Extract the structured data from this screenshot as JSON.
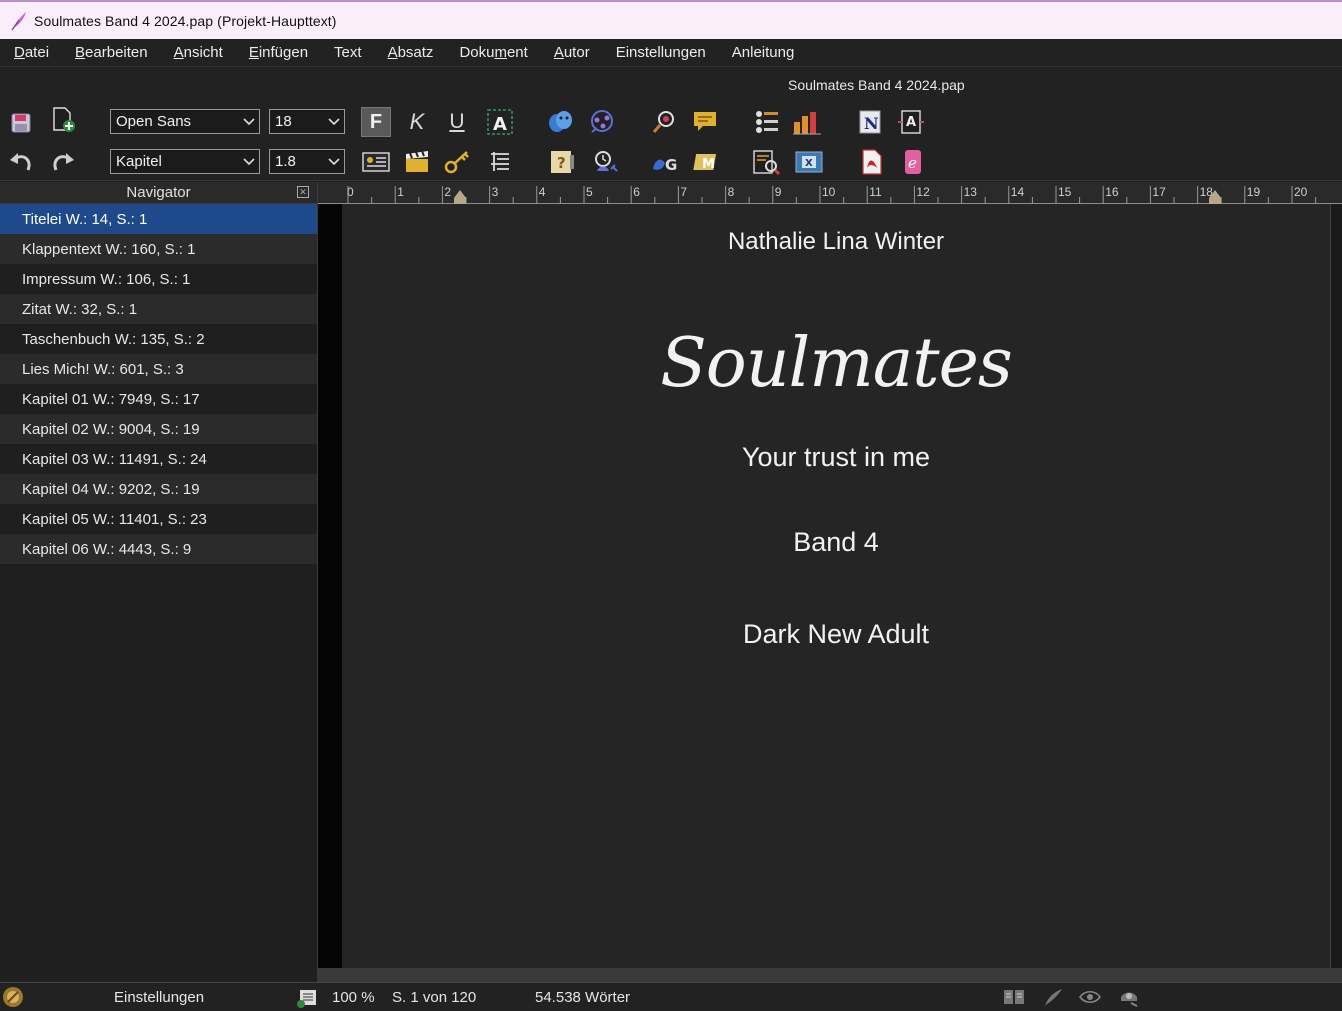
{
  "window": {
    "title": "Soulmates Band 4 2024.pap  (Projekt-Haupttext)"
  },
  "menu": [
    {
      "pre": "",
      "key": "D",
      "post": "atei"
    },
    {
      "pre": "",
      "key": "B",
      "post": "earbeiten"
    },
    {
      "pre": "",
      "key": "A",
      "post": "nsicht"
    },
    {
      "pre": "",
      "key": "E",
      "post": "infügen"
    },
    {
      "pre": "Text",
      "key": "",
      "post": ""
    },
    {
      "pre": "",
      "key": "A",
      "post": "bsatz"
    },
    {
      "pre": "Doku",
      "key": "m",
      "post": "ent"
    },
    {
      "pre": "",
      "key": "A",
      "post": "utor"
    },
    {
      "pre": "Einstellungen",
      "key": "",
      "post": ""
    },
    {
      "pre": "Anleitung",
      "key": "",
      "post": ""
    }
  ],
  "document_title": "Soulmates Band 4 2024.pap",
  "toolbar": {
    "font_family": "Open Sans",
    "font_size": "18",
    "style": "Kapitel",
    "line_spacing": "1.8"
  },
  "navigator": {
    "header": "Navigator",
    "items": [
      {
        "label": "Titelei  W.: 14, S.: 1"
      },
      {
        "label": "Klappentext  W.: 160, S.: 1"
      },
      {
        "label": "Impressum  W.: 106, S.: 1"
      },
      {
        "label": "Zitat  W.: 32, S.: 1"
      },
      {
        "label": "Taschenbuch  W.: 135, S.: 2"
      },
      {
        "label": "Lies Mich!  W.: 601, S.: 3"
      },
      {
        "label": "Kapitel 01  W.: 7949, S.: 17"
      },
      {
        "label": "Kapitel 02  W.: 9004, S.: 19"
      },
      {
        "label": "Kapitel 03  W.: 11491, S.: 24"
      },
      {
        "label": "Kapitel 04  W.: 9202, S.: 19"
      },
      {
        "label": "Kapitel 05  W.: 11401, S.: 23"
      },
      {
        "label": "Kapitel 06  W.: 4443, S.: 9"
      }
    ],
    "selected_index": 0
  },
  "ruler": {
    "ticks": [
      "0",
      "1",
      "2",
      "3",
      "4",
      "5",
      "6",
      "7",
      "8",
      "9",
      "10",
      "11",
      "12",
      "13",
      "14",
      "15",
      "16",
      "17",
      "18",
      "19",
      "20"
    ]
  },
  "document": {
    "author": "Nathalie Lina Winter",
    "title": "Soulmates",
    "subtitle": "Your trust in me",
    "band": "Band 4",
    "genre": "Dark New Adult"
  },
  "statusbar": {
    "settings": "Einstellungen",
    "zoom": "100 %",
    "page": "S. 1 von 120",
    "words": "54.538 Wörter"
  }
}
